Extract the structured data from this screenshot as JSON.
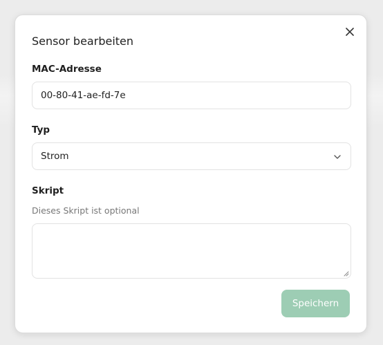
{
  "dialog": {
    "title": "Sensor bearbeiten",
    "close_icon": "close-icon"
  },
  "mac": {
    "label": "MAC-Adresse",
    "value": "00-80-41-ae-fd-7e"
  },
  "type": {
    "label": "Typ",
    "selected": "Strom",
    "icon": "chevron-down-icon"
  },
  "script": {
    "label": "Skript",
    "hint": "Dieses Skript ist optional",
    "value": ""
  },
  "actions": {
    "save_label": "Speichern",
    "save_color": "#9dcdb4"
  }
}
